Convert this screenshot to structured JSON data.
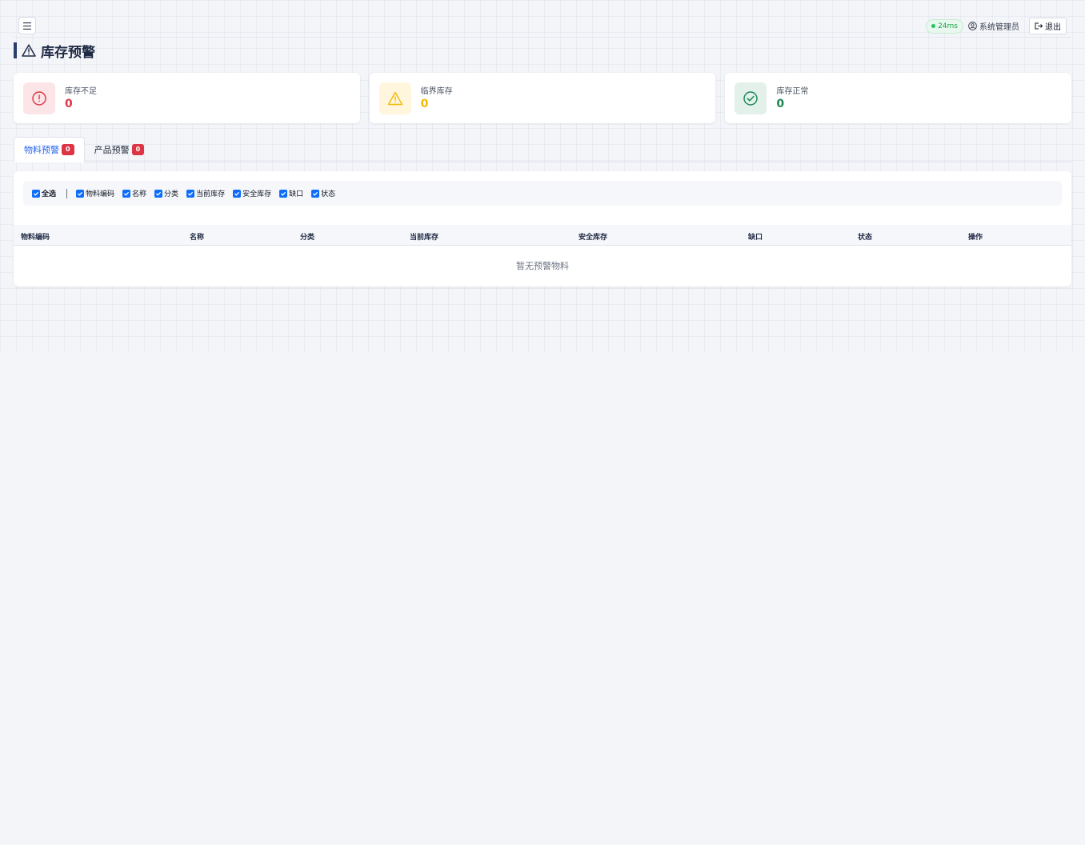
{
  "header": {
    "latency": "24ms",
    "user_name": "系统管理员",
    "logout_label": "退出"
  },
  "page": {
    "title": "库存预警"
  },
  "stats": [
    {
      "label": "库存不足",
      "value": "0",
      "color": "#dc3545",
      "icon": "alert-circle-icon"
    },
    {
      "label": "临界库存",
      "value": "0",
      "color": "#f5b800",
      "icon": "warning-triangle-icon"
    },
    {
      "label": "库存正常",
      "value": "0",
      "color": "#198754",
      "icon": "check-circle-icon"
    }
  ],
  "tabs": [
    {
      "label": "物料预警",
      "badge": "0",
      "active": true
    },
    {
      "label": "产品预警",
      "badge": "0",
      "active": false
    }
  ],
  "column_toggle": {
    "select_all": "全选",
    "columns": [
      "物料编码",
      "名称",
      "分类",
      "当前库存",
      "安全库存",
      "缺口",
      "状态"
    ]
  },
  "table": {
    "headers": [
      "物料编码",
      "名称",
      "分类",
      "当前库存",
      "安全库存",
      "缺口",
      "状态",
      "操作"
    ],
    "empty_text": "暂无预警物料"
  },
  "colors": {
    "accent": "#2563eb",
    "title_bar": "#2b3d6e",
    "checkbox": "#0d6efd"
  }
}
